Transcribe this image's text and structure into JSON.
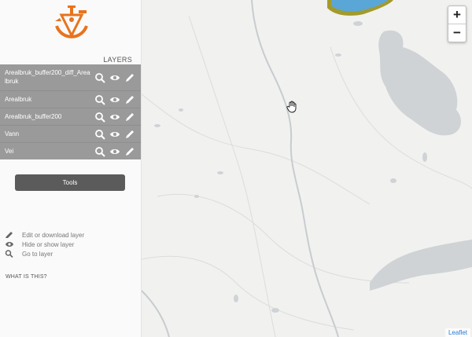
{
  "sidebar": {
    "layers_title": "LAYERS",
    "layers": [
      {
        "name": "Arealbruk_buffer200_diff_Arealbruk"
      },
      {
        "name": "Arealbruk"
      },
      {
        "name": "Arealbruk_buffer200"
      },
      {
        "name": "Vann"
      },
      {
        "name": "Vei"
      }
    ],
    "tools_label": "Tools",
    "legend": [
      {
        "icon": "pencil-icon",
        "text": "Edit or download layer"
      },
      {
        "icon": "eye-icon",
        "text": "Hide or show layer"
      },
      {
        "icon": "search-icon",
        "text": "Go to layer"
      }
    ],
    "what_is_this": "WHAT IS THIS?"
  },
  "map": {
    "zoom_in_label": "+",
    "zoom_out_label": "−",
    "attribution": "Leaflet",
    "colors": {
      "water": "#cfd3d6",
      "land": "#f1f1ef",
      "layer_fill": "#5aa6d6",
      "layer_border": "#a39a2c"
    }
  },
  "brand": {
    "logo_icon": "sextant-logo-icon",
    "logo_color": "#e8731c"
  }
}
